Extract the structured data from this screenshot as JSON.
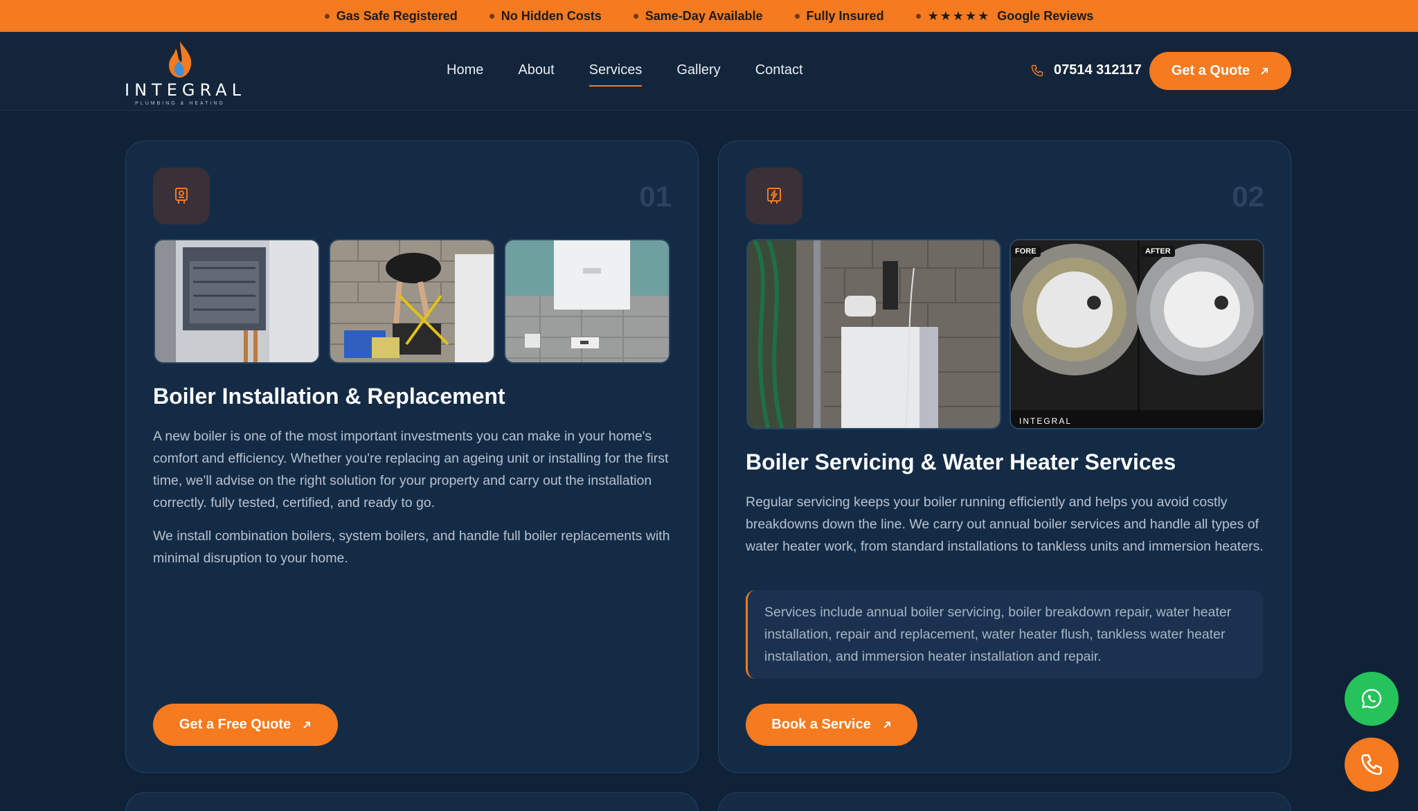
{
  "topbar": {
    "items": [
      {
        "label": "Gas Safe Registered"
      },
      {
        "label": "No Hidden Costs"
      },
      {
        "label": "Same-Day Available"
      },
      {
        "label": "Fully Insured"
      },
      {
        "stars": "★★★★★",
        "label": "Google Reviews"
      }
    ]
  },
  "header": {
    "logo_word": "INTEGRAL",
    "logo_sub": "PLUMBING & HEATING",
    "nav": [
      "Home",
      "About",
      "Services",
      "Gallery",
      "Contact"
    ],
    "active_nav": "Services",
    "phone": "07514 312117",
    "quote_label": "Get a Quote"
  },
  "cards": [
    {
      "number": "01",
      "icon": "boiler-icon",
      "title": "Boiler Installation & Replacement",
      "paragraphs": [
        "A new boiler is one of the most important investments you can make in your home's comfort and efficiency. Whether you're replacing an ageing unit or installing for the first time, we'll advise on the right solution for your property and carry out the installation correctly. fully tested, certified, and ready to go.",
        "We install combination boilers, system boilers, and handle full boiler replacements with minimal disruption to your home."
      ],
      "cta": "Get a Free Quote"
    },
    {
      "number": "02",
      "icon": "lightning-icon",
      "title": "Boiler Servicing & Water Heater Services",
      "paragraphs": [
        "Regular servicing keeps your boiler running efficiently and helps you avoid costly breakdowns down the line. We carry out annual boiler services and handle all types of water heater work, from standard installations to tankless units and immersion heaters."
      ],
      "note": "Services include annual boiler servicing, boiler breakdown repair, water heater installation, repair and replacement, water heater flush, tankless water heater installation, and immersion heater installation and repair.",
      "before_tag": "FORE",
      "after_tag": "AFTER",
      "cta": "Book a Service"
    }
  ],
  "colors": {
    "accent": "#f57a20",
    "bg": "#0f2238",
    "card": "#142b46",
    "whatsapp": "#25c35a"
  }
}
